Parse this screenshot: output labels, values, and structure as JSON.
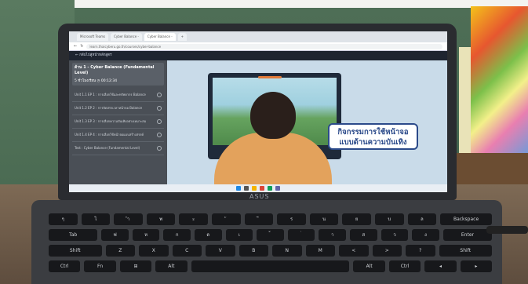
{
  "browser": {
    "tabs": [
      "Microsoft Teams",
      "Cyber Balance - ",
      "Cyber Balance - ",
      "+"
    ],
    "url": "learn.thaicyberu.go.th/courses/cyber-balance"
  },
  "lms": {
    "back_link": "← กลับไปสู่หน้าหลักสูตร",
    "course_title": "ด้าน 1 - Cyber Balance (Fundamental Level)",
    "course_meta_lessons": "5 ชั่วโมงเรียน",
    "course_meta_time": "00:12:34",
    "units": [
      "Unit 1.1 EP 1 : การเลือกใช้และทรัพยากร Balance",
      "Unit 1.2 EP 2 : การจัดสรรเวลาหน้าจอ Balance",
      "Unit 1.3 EP 3 : การเลือกความบันเทิงอย่างเหมาะสม",
      "Unit 1.4 EP 4 : การเลือกใช้หน้าจอแบบสร้างสรรค์",
      "Test : Cyber Balance (Fundamental Level)"
    ]
  },
  "video": {
    "caption": "กิจกรรมการใช้หน้าจอ แบบด้านความบันเทิง"
  },
  "laptop": {
    "brand": "ASUS"
  },
  "keyboard": {
    "row1": [
      "ๆ",
      "ไ",
      "ำ",
      "พ",
      "ะ",
      "ั",
      "ี",
      "ร",
      "น",
      "ย",
      "บ",
      "ล",
      "Backspace"
    ],
    "row2": [
      "Tab",
      "ฟ",
      "ห",
      "ก",
      "ด",
      "เ",
      "้",
      "่",
      "า",
      "ส",
      "ว",
      "ง",
      "Enter"
    ],
    "row3": [
      "Shift",
      "Z",
      "X",
      "C",
      "V",
      "B",
      "N",
      "M",
      "<",
      ">",
      "?",
      "Shift"
    ],
    "row4": [
      "Ctrl",
      "Fn",
      "⊞",
      "Alt",
      "",
      "Alt",
      "Ctrl",
      "◂",
      "▸"
    ]
  },
  "colors": {
    "caption_border": "#2b4a8a",
    "shirt": "#e3a25c"
  }
}
